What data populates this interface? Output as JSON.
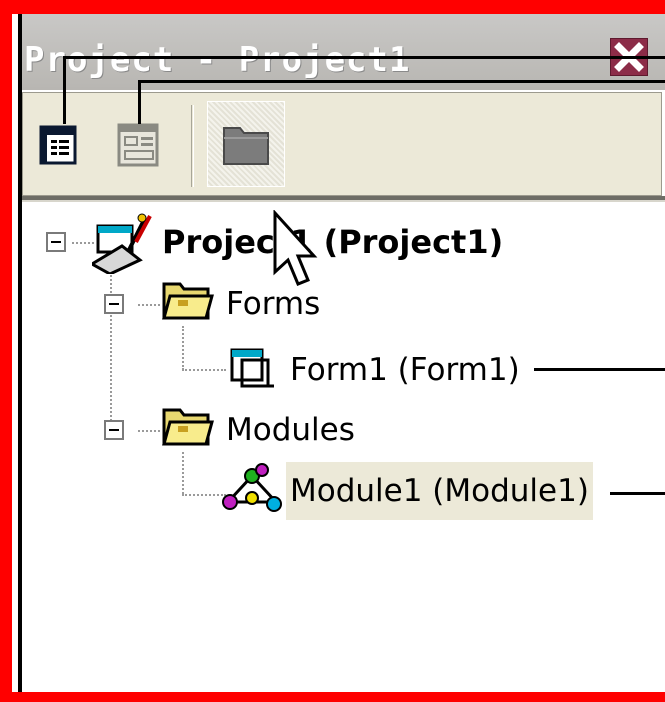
{
  "window": {
    "title": "Project - Project1"
  },
  "toolbar": {
    "view_code_icon": "view-code-icon",
    "view_object_icon": "view-object-icon",
    "toggle_folders_icon": "folder-icon"
  },
  "tree": {
    "root": {
      "label": "Project1 (Project1)",
      "icon": "vb-project-icon"
    },
    "forms": {
      "label": "Forms",
      "icon": "folder-icon"
    },
    "form1": {
      "label": "Form1 (Form1)",
      "icon": "form-icon"
    },
    "modules": {
      "label": "Modules",
      "icon": "folder-icon"
    },
    "module1": {
      "label": "Module1 (Module1)",
      "icon": "module-icon"
    }
  },
  "colors": {
    "highlight_border": "#ff0000",
    "selection": "#ece9d8"
  }
}
